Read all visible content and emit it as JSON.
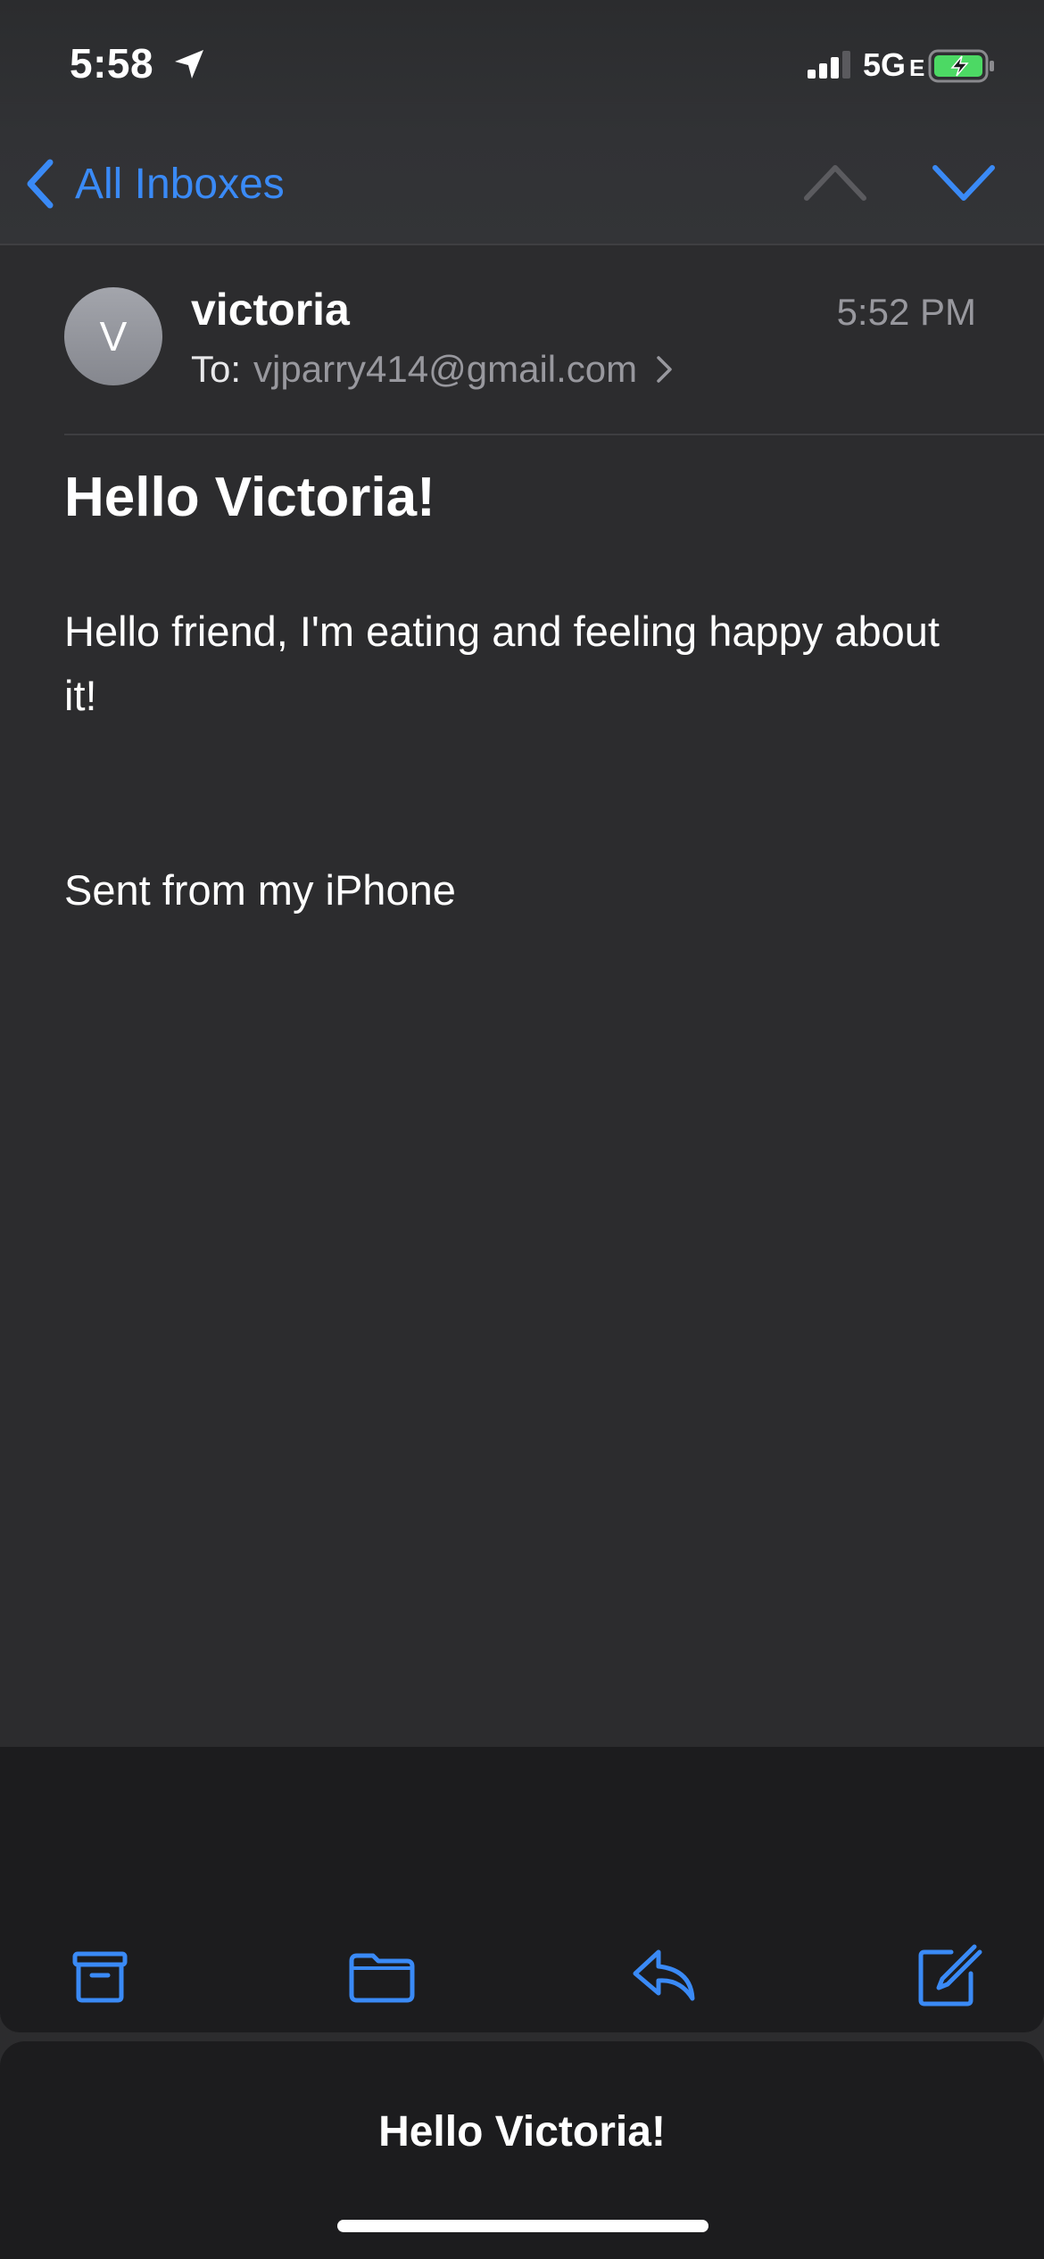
{
  "status_bar": {
    "time": "5:58",
    "network": "5G",
    "network_suffix": "E",
    "icons": [
      "location-arrow-icon",
      "cellular-signal-icon",
      "battery-charging-icon"
    ],
    "battery_color": "#4cd964"
  },
  "nav": {
    "back_label": "All Inboxes",
    "back_icon": "chevron-left-icon",
    "prev_icon": "chevron-up-icon",
    "next_icon": "chevron-down-icon",
    "prev_enabled": false,
    "next_enabled": true
  },
  "message": {
    "avatar_initial": "V",
    "sender": "victoria",
    "time": "5:52 PM",
    "to_label": "To:",
    "recipient": "vjparry414@gmail.com",
    "subject": "Hello Victoria!",
    "body": "Hello friend, I'm eating and feeling happy about it!",
    "signature": "Sent from my iPhone"
  },
  "toolbar": {
    "actions": [
      {
        "name": "archive",
        "icon": "archive-box-icon"
      },
      {
        "name": "move",
        "icon": "folder-icon"
      },
      {
        "name": "reply",
        "icon": "reply-arrow-icon"
      },
      {
        "name": "compose",
        "icon": "compose-icon"
      }
    ]
  },
  "draft": {
    "title": "Hello Victoria!"
  },
  "colors": {
    "accent": "#3a8af6",
    "background": "#2c2c2e",
    "secondary_text": "#98989e",
    "toolbar": "#1c1c1e"
  }
}
